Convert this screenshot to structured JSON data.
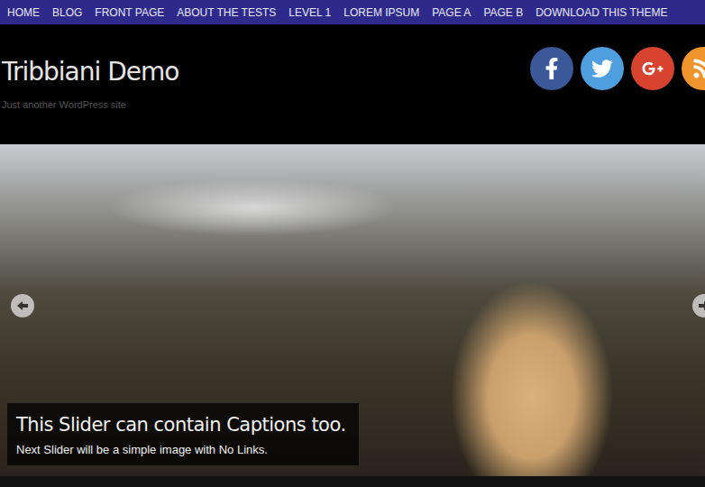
{
  "nav": {
    "items": [
      "HOME",
      "BLOG",
      "FRONT PAGE",
      "ABOUT THE TESTS",
      "LEVEL 1",
      "LOREM IPSUM",
      "PAGE A",
      "PAGE B",
      "DOWNLOAD THIS THEME"
    ]
  },
  "header": {
    "title": "Tribbiani Demo",
    "tagline": "Just another WordPress site"
  },
  "social": [
    {
      "name": "facebook",
      "color": "#3b5998"
    },
    {
      "name": "twitter",
      "color": "#4f9fe0"
    },
    {
      "name": "google-plus",
      "color": "#d8432f"
    },
    {
      "name": "rss",
      "color": "#f0952b"
    }
  ],
  "slider": {
    "caption_title": "This Slider can contain Captions too.",
    "caption_text": "Next Slider will be a simple image with No Links."
  }
}
